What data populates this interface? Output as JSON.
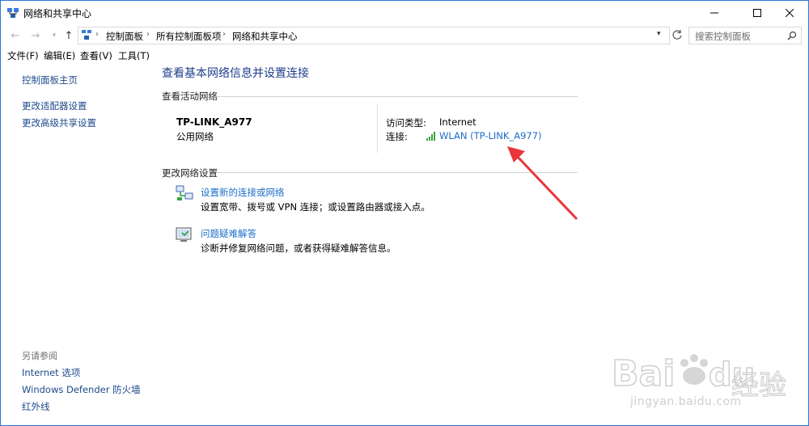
{
  "window": {
    "title": "网络和共享中心",
    "accent": "#2b78d6"
  },
  "address": {
    "crumbs": [
      "控制面板",
      "所有控制面板项",
      "网络和共享中心"
    ],
    "search_placeholder": "搜索控制面板"
  },
  "menu": [
    "文件(F)",
    "编辑(E)",
    "查看(V)",
    "工具(T)"
  ],
  "sidebar": {
    "home": "控制面板主页",
    "links": [
      "更改适配器设置",
      "更改高级共享设置"
    ],
    "see_also_heading": "另请参阅",
    "see_also": [
      "Internet 选项",
      "Windows Defender 防火墙",
      "红外线"
    ]
  },
  "main": {
    "title": "查看基本网络信息并设置连接",
    "active_section": "查看活动网络",
    "network": {
      "name": "TP-LINK_A977",
      "category": "公用网络",
      "access_key": "访问类型:",
      "access_value": "Internet",
      "conn_key": "连接:",
      "conn_value": "WLAN (TP-LINK_A977)"
    },
    "change_section": "更改网络设置",
    "tasks": [
      {
        "title": "设置新的连接或网络",
        "desc": "设置宽带、拨号或 VPN 连接；或设置路由器或接入点。",
        "icon": "network-setup-icon"
      },
      {
        "title": "问题疑难解答",
        "desc": "诊断并修复网络问题，或者获得疑难解答信息。",
        "icon": "troubleshoot-icon"
      }
    ]
  },
  "watermark": {
    "brand": "Baidu经验",
    "url": "jingyan.baidu.com"
  }
}
